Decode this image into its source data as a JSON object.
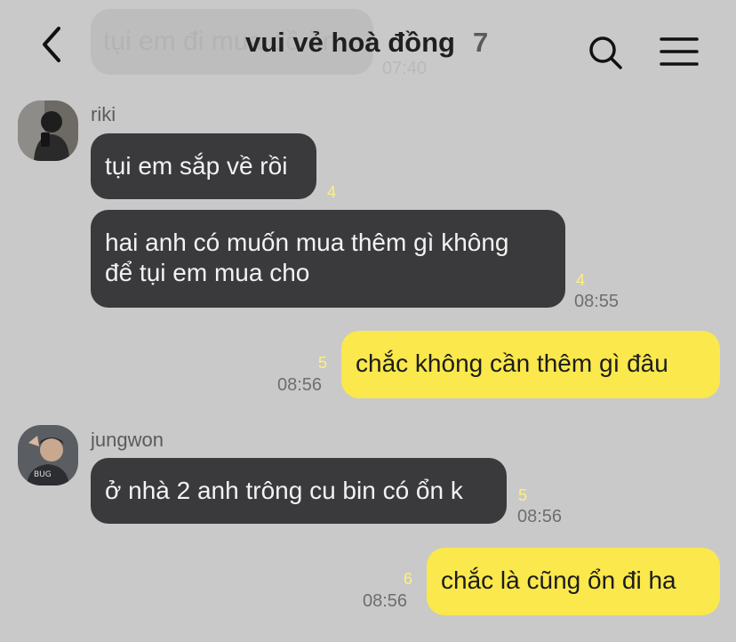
{
  "header": {
    "ghost_message": "tụi em đi mua đồ ăn",
    "ghost_time": "07:40",
    "title": "vui vẻ hoà đồng",
    "member_count": "7",
    "icons": {
      "back": "chevron-left-icon",
      "search": "search-icon",
      "menu": "hamburger-menu-icon"
    }
  },
  "messages": [
    {
      "sender": "riki",
      "text": "tụi em sắp về rồi",
      "unread": "4",
      "time": ""
    },
    {
      "sender": "riki",
      "lines": [
        "hai anh có muốn mua thêm gì không",
        "để tụi em mua cho"
      ],
      "unread": "4",
      "time": "08:55"
    },
    {
      "sender": "me",
      "text": "chắc không cần thêm gì đâu",
      "unread": "5",
      "time": "08:56"
    },
    {
      "sender": "jungwon",
      "text": "ở nhà 2 anh trông cu bin có ổn k",
      "unread": "5",
      "time": "08:56"
    },
    {
      "sender": "me",
      "text": "chắc là cũng ổn đi ha",
      "unread": "6",
      "time": "08:56"
    }
  ],
  "senders": {
    "riki": {
      "name": "riki"
    },
    "jungwon": {
      "name": "jungwon"
    }
  },
  "colors": {
    "background": "#c9c9c9",
    "incoming_bubble": "#3a3a3c",
    "outgoing_bubble": "#fae84c",
    "unread_count": "#fff07a"
  }
}
